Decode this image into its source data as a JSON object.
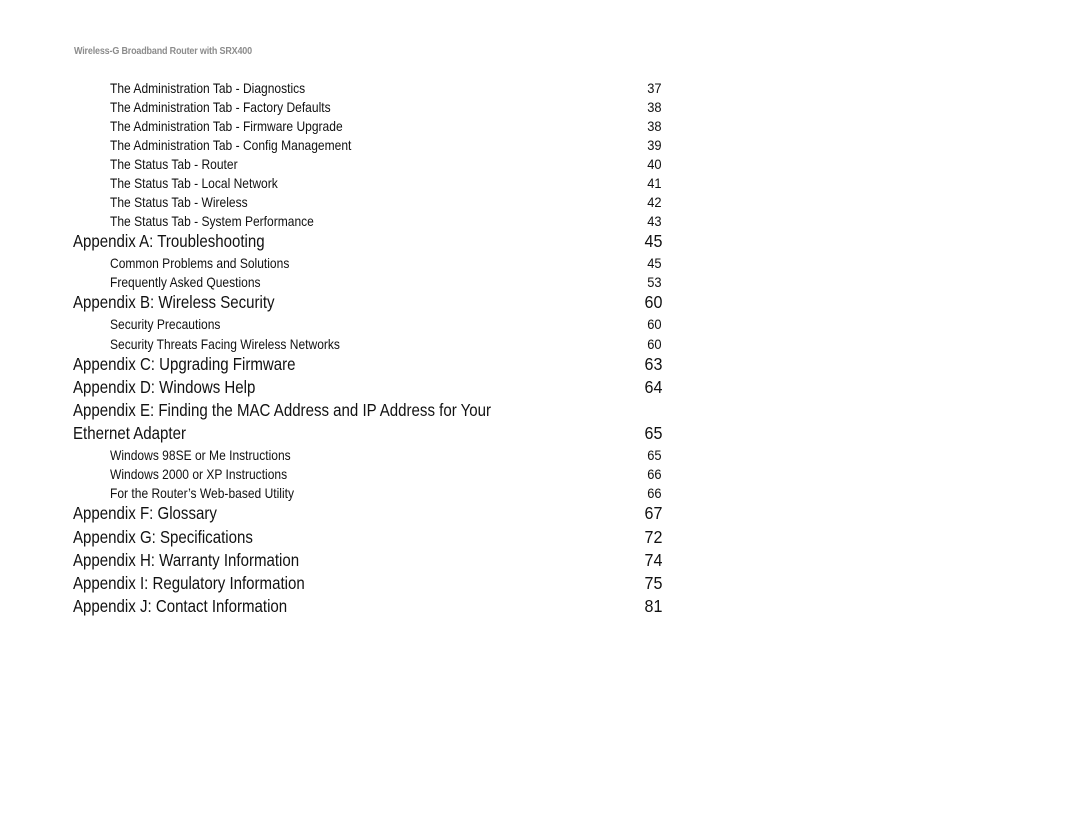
{
  "header": {
    "title": "Wireless-G Broadband Router with SRX400"
  },
  "toc": [
    {
      "level": "sub",
      "title": "The Administration Tab - Diagnostics",
      "page": "37"
    },
    {
      "level": "sub",
      "title": "The Administration Tab - Factory Defaults",
      "page": "38"
    },
    {
      "level": "sub",
      "title": "The Administration Tab - Firmware Upgrade",
      "page": "38"
    },
    {
      "level": "sub",
      "title": "The Administration Tab - Config Management",
      "page": "39"
    },
    {
      "level": "sub",
      "title": "The Status Tab - Router",
      "page": "40"
    },
    {
      "level": "sub",
      "title": "The Status Tab - Local Network",
      "page": "41"
    },
    {
      "level": "sub",
      "title": "The Status Tab - Wireless",
      "page": "42"
    },
    {
      "level": "sub",
      "title": "The Status Tab - System Performance",
      "page": "43"
    },
    {
      "level": "main",
      "title": "Appendix A: Troubleshooting",
      "page": "45"
    },
    {
      "level": "sub",
      "title": "Common Problems and Solutions",
      "page": "45"
    },
    {
      "level": "sub",
      "title": "Frequently Asked Questions",
      "page": "53"
    },
    {
      "level": "main",
      "title": "Appendix B: Wireless Security",
      "page": "60"
    },
    {
      "level": "sub",
      "title": "Security Precautions",
      "page": "60"
    },
    {
      "level": "sub",
      "title": "Security Threats Facing Wireless Networks",
      "page": "60"
    },
    {
      "level": "main",
      "title": "Appendix C: Upgrading Firmware",
      "page": "63"
    },
    {
      "level": "main",
      "title": "Appendix D: Windows Help",
      "page": "64"
    },
    {
      "level": "main",
      "title": "Appendix E: Finding the MAC Address and IP Address for Your",
      "page": ""
    },
    {
      "level": "main",
      "title": "Ethernet Adapter",
      "page": "65"
    },
    {
      "level": "sub",
      "title": "Windows 98SE or Me Instructions",
      "page": "65"
    },
    {
      "level": "sub",
      "title": "Windows 2000 or XP Instructions",
      "page": "66"
    },
    {
      "level": "sub",
      "title": "For the Router’s Web-based Utility",
      "page": "66"
    },
    {
      "level": "main",
      "title": "Appendix F: Glossary",
      "page": "67"
    },
    {
      "level": "main",
      "title": "Appendix G: Specifications",
      "page": "72"
    },
    {
      "level": "main",
      "title": "Appendix H: Warranty Information",
      "page": "74"
    },
    {
      "level": "main",
      "title": "Appendix I: Regulatory Information",
      "page": "75"
    },
    {
      "level": "main",
      "title": "Appendix J: Contact Information",
      "page": "81"
    }
  ]
}
